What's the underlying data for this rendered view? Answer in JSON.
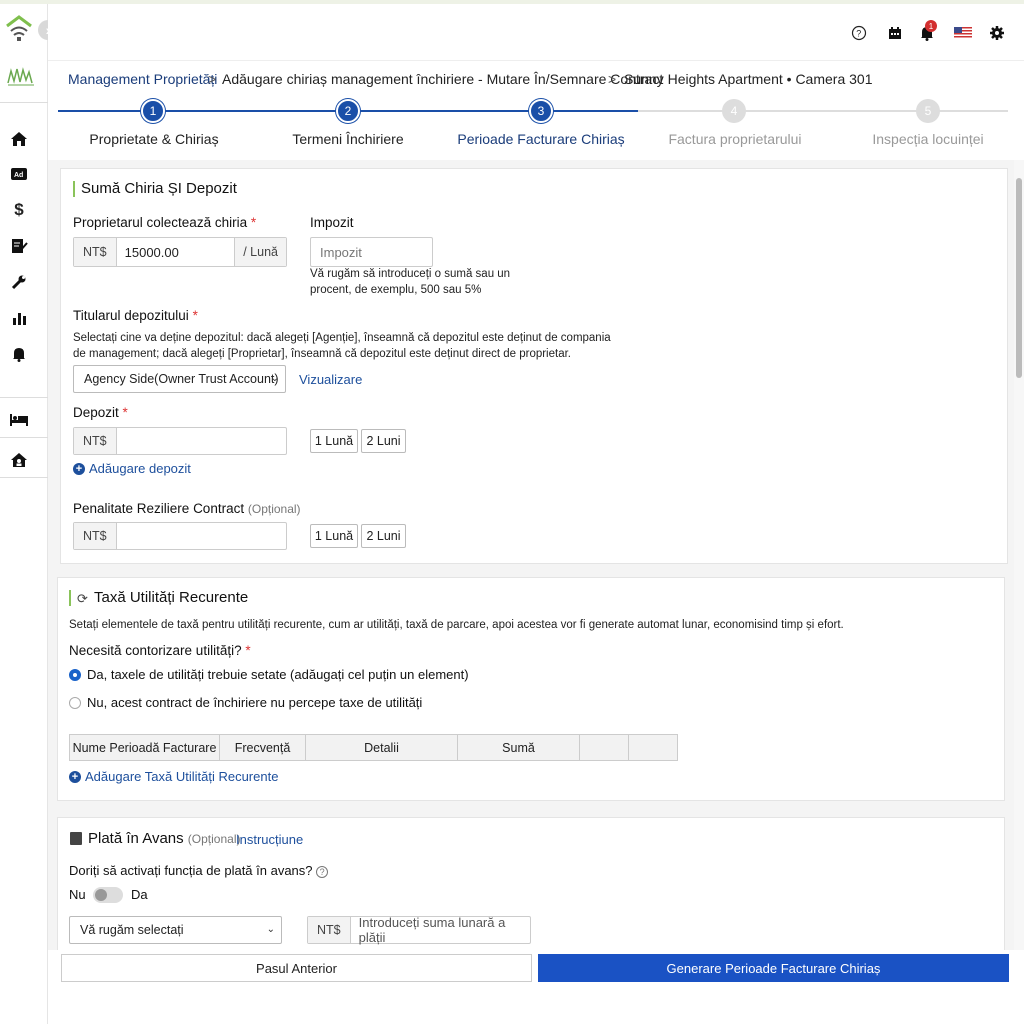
{
  "breadcrumb": {
    "root": "Management Proprietăți",
    "sep1": ">",
    "middle": "Adăugare chiriaș management închiriere - Mutare În/Semnare Contract",
    "sep2": ">",
    "current": "Sunny Heights Apartment • Camera 301"
  },
  "steps": [
    {
      "num": "1",
      "label": "Proprietate & Chiriaș",
      "state": "done"
    },
    {
      "num": "2",
      "label": "Termeni Închiriere",
      "state": "done"
    },
    {
      "num": "3",
      "label": "Perioade Facturare Chiriaș",
      "state": "active"
    },
    {
      "num": "4",
      "label": "Factura proprietarului",
      "state": "pending"
    },
    {
      "num": "5",
      "label": "Inspecția locuinței",
      "state": "pending"
    }
  ],
  "topbar": {
    "notification_count": "1"
  },
  "rent_card": {
    "title": "Sumă Chiria ȘI Depozit",
    "landlord_rent_label": "Proprietarul colectează chiria",
    "currency": "NT$",
    "rent_value": "15000.00",
    "rent_period": "/ Lună",
    "tax_label": "Impozit",
    "tax_placeholder": "Impozit",
    "tax_hint": "Vă rugăm să introduceți o sumă sau un procent, de exemplu, 500 sau 5%",
    "deposit_holder_label": "Titularul depozitului",
    "deposit_holder_hint": "Selectați cine va deține depozitul: dacă alegeți [Agenție], înseamnă că depozitul este deținut de compania de management; dacă alegeți [Proprietar], înseamnă că depozitul este deținut direct de proprietar.",
    "deposit_holder_value": "Agency Side(Owner Trust Account)",
    "view_link": "Vizualizare",
    "deposit_label": "Depozit",
    "one_month": "1 Lună",
    "two_months": "2 Luni",
    "add_deposit": "Adăugare depozit",
    "penalty_label": "Penalitate Reziliere Contract",
    "optional": "(Opțional)"
  },
  "utility_card": {
    "title": "Taxă Utilități Recurente",
    "description": "Setați elementele de taxă pentru utilități recurente, cum ar utilități, taxă de parcare, apoi acestea vor fi generate automat lunar, economisind timp și efort.",
    "metering_label": "Necesită contorizare utilități?",
    "option_yes": "Da, taxele de utilități trebuie setate (adăugați cel puțin un element)",
    "option_no": "Nu, acest contract de închiriere nu percepe taxe de utilități",
    "columns": [
      "Nume Perioadă Facturare",
      "Frecvență",
      "Detalii",
      "Sumă",
      "",
      ""
    ],
    "add_link": "Adăugare Taxă Utilități Recurente"
  },
  "advance_card": {
    "title": "Plată în Avans",
    "optional": "(Opțional)",
    "instructions_link": "Instrucțiune",
    "question": "Doriți să activați funcția de plată în avans?",
    "toggle_off": "Nu",
    "toggle_on": "Da",
    "select_placeholder": "Vă rugăm selectați",
    "currency": "NT$",
    "amount_placeholder": "Introduceți suma lunară a plății"
  },
  "footer": {
    "prev": "Pasul Anterior",
    "next": "Generare Perioade Facturare Chiriaș"
  },
  "colors": {
    "primary": "#1a52c4",
    "step_active": "#1a4fa8",
    "accent_bar": "#8ac35a"
  }
}
